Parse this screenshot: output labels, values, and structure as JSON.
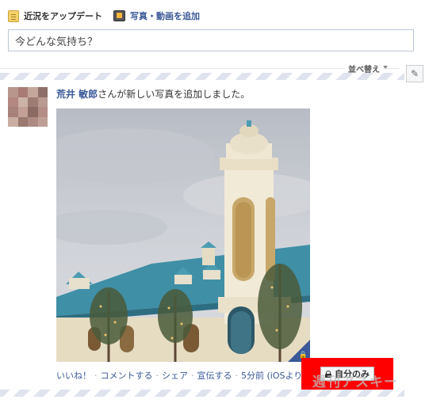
{
  "composer": {
    "tabs": [
      {
        "label": "近況をアップデート",
        "icon": "status-note-icon"
      },
      {
        "label": "写真・動画を追加",
        "icon": "photo-icon"
      }
    ],
    "placeholder": "今どんな気持ち？"
  },
  "feed": {
    "sort_label": "並べ替え",
    "edit_icon": "pencil-icon"
  },
  "story": {
    "author": "荒井 敏郎",
    "action_text": "さんが新しい写真を追加しました。",
    "photo_icon": "church-tower-photo",
    "actions": {
      "like": "いいね！",
      "comment": "コメントする",
      "share": "シェア",
      "promote": "宣伝する",
      "timestamp": "5分前 (iOSより)",
      "separator": "·"
    },
    "privacy_label": "自分のみ",
    "privacy_icon": "lock-icon"
  },
  "watermark": "週刊アスキー",
  "colors": {
    "link": "#3b5998",
    "highlight": "#ff0000",
    "stripe": "#dfe3ee"
  }
}
